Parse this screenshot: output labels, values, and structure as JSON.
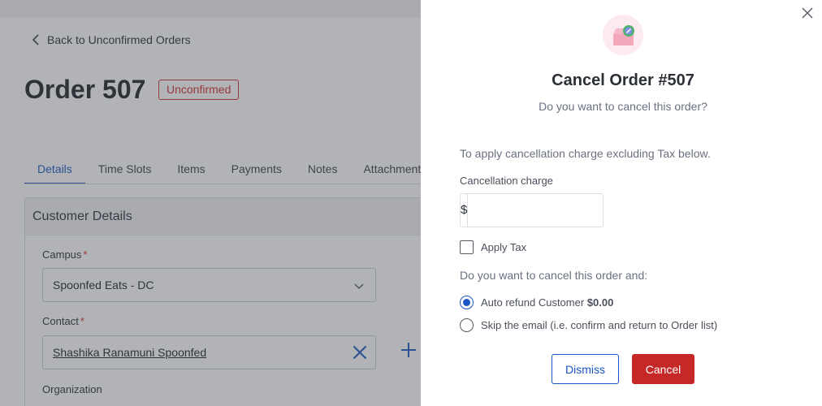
{
  "background": {
    "back_link": "Back to Unconfirmed Orders",
    "order_title": "Order 507",
    "status_badge": "Unconfirmed",
    "tabs": [
      {
        "label": "Details",
        "active": true
      },
      {
        "label": "Time Slots",
        "active": false
      },
      {
        "label": "Items",
        "active": false
      },
      {
        "label": "Payments",
        "active": false
      },
      {
        "label": "Notes",
        "active": false
      },
      {
        "label": "Attachment",
        "active": false
      }
    ],
    "customer_details": {
      "header": "Customer Details",
      "campus_label": "Campus",
      "campus_value": "Spoonfed Eats - DC",
      "contact_label": "Contact",
      "contact_value": "Shashika Ranamuni Spoonfed",
      "organization_label": "Organization",
      "required_marker": "*"
    }
  },
  "modal": {
    "title": "Cancel Order #507",
    "subtitle": "Do you want to cancel this order?",
    "instruction": "To apply cancellation charge excluding Tax below.",
    "charge_label": "Cancellation charge",
    "currency_symbol": "$",
    "charge_value": "",
    "apply_tax_label": "Apply Tax",
    "apply_tax_checked": false,
    "question": "Do you want to cancel this order and:",
    "options": {
      "auto_refund_label": "Auto refund Customer",
      "auto_refund_amount": "$0.00",
      "skip_email_label": "Skip the email (i.e. confirm and return to Order list)"
    },
    "selected_option": "auto_refund",
    "dismiss_label": "Dismiss",
    "cancel_label": "Cancel"
  },
  "colors": {
    "accent": "#1a56c4",
    "danger": "#c62828",
    "badge": "#d32f2f"
  },
  "icons": {
    "back": "chevron-left-icon",
    "close": "close-icon",
    "modal": "cancel-order-icon",
    "select": "chevron-down-icon",
    "clear": "clear-x-icon",
    "add": "plus-icon"
  }
}
